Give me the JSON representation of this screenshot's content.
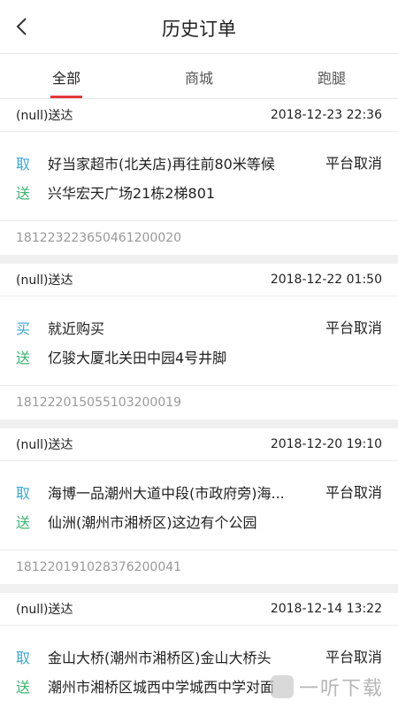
{
  "navbar": {
    "title": "历史订单"
  },
  "tabs": [
    {
      "label": "全部",
      "active": true
    },
    {
      "label": "商城",
      "active": false
    },
    {
      "label": "跑腿",
      "active": false
    }
  ],
  "orders": [
    {
      "type": "(null)送达",
      "time": "2018-12-23 22:36",
      "pickup_tag": "取",
      "pickup": "好当家超市(北关店)再往前80米等候",
      "deliver_tag": "送",
      "deliver": "兴华宏天广场21栋2梯801",
      "status": "平台取消",
      "order_no": "181223223650461200020"
    },
    {
      "type": "(null)送达",
      "time": "2018-12-22 01:50",
      "pickup_tag": "买",
      "pickup": "就近购买",
      "deliver_tag": "送",
      "deliver": "亿骏大厦北关田中园4号井脚",
      "status": "平台取消",
      "order_no": "181222015055103200019"
    },
    {
      "type": "(null)送达",
      "time": "2018-12-20 19:10",
      "pickup_tag": "取",
      "pickup": "海博一品潮州大道中段(市政府旁)海...",
      "deliver_tag": "送",
      "deliver": "仙洲(潮州市湘桥区)这边有个公园",
      "status": "平台取消",
      "order_no": "181220191028376200041"
    },
    {
      "type": "(null)送达",
      "time": "2018-12-14 13:22",
      "pickup_tag": "取",
      "pickup": "金山大桥(潮州市湘桥区)金山大桥头",
      "deliver_tag": "送",
      "deliver": "潮州市湘桥区城西中学城西中学对面",
      "status": "平台取消",
      "order_no": ""
    }
  ],
  "watermark": {
    "text": "一听下载"
  },
  "colors": {
    "accent": "#e4393c",
    "pickup": "#3aa6d9",
    "deliver": "#3cb46e"
  }
}
